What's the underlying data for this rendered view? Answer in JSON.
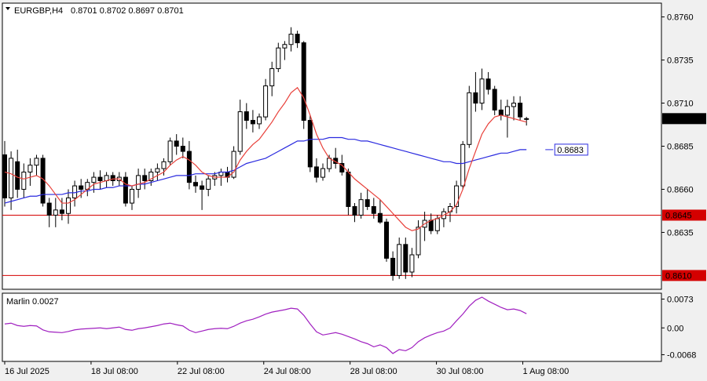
{
  "header": {
    "symbol": "EURGBP,H4",
    "ohlc": "0.8701 0.8702 0.8697 0.8701"
  },
  "indicator": {
    "label": "Marlin 0.0027"
  },
  "colors": {
    "bull": "#ffffff",
    "bear": "#000000",
    "ma_fast": "#e8403a",
    "ma_slow": "#2a2adf",
    "levels": "#d40000",
    "osc": "#a020c0",
    "price_tag": "#000000",
    "ma_tag": "#2a2adf"
  },
  "chart_data": [
    {
      "type": "candlestick",
      "price_axis": {
        "ticks": [
          "0.8760",
          "0.8735",
          "0.8710",
          "0.8685",
          "0.8660",
          "0.8635"
        ],
        "ylim": [
          0.8602,
          0.8768
        ]
      },
      "time_axis": {
        "labels": [
          "16 Jul 2025",
          "18 Jul 08:00",
          "22 Jul 08:00",
          "24 Jul 08:00",
          "28 Jul 08:00",
          "30 Jul 08:00",
          "1 Aug 08:00"
        ]
      },
      "current_price": "0.8701",
      "ma_value_label": "0.8683",
      "levels": [
        {
          "value": 0.8645,
          "label": "0.8645"
        },
        {
          "value": 0.861,
          "label": "0.8610"
        }
      ],
      "candles": [
        [
          0.868,
          0.8688,
          0.865,
          0.8655
        ],
        [
          0.8655,
          0.8682,
          0.8648,
          0.8678
        ],
        [
          0.8676,
          0.8683,
          0.8655,
          0.866
        ],
        [
          0.866,
          0.8675,
          0.8655,
          0.867
        ],
        [
          0.867,
          0.8678,
          0.8662,
          0.8674
        ],
        [
          0.8674,
          0.868,
          0.8668,
          0.8678
        ],
        [
          0.8678,
          0.868,
          0.865,
          0.8652
        ],
        [
          0.8652,
          0.8655,
          0.8638,
          0.8645
        ],
        [
          0.8645,
          0.8655,
          0.8638,
          0.8648
        ],
        [
          0.8648,
          0.8655,
          0.8642,
          0.8646
        ],
        [
          0.8646,
          0.866,
          0.864,
          0.8655
        ],
        [
          0.8655,
          0.8665,
          0.865,
          0.8662
        ],
        [
          0.8662,
          0.8666,
          0.8655,
          0.866
        ],
        [
          0.866,
          0.8666,
          0.8656,
          0.8664
        ],
        [
          0.8664,
          0.867,
          0.8658,
          0.8667
        ],
        [
          0.8667,
          0.8671,
          0.866,
          0.8665
        ],
        [
          0.8665,
          0.867,
          0.8661,
          0.8668
        ],
        [
          0.8668,
          0.867,
          0.8662,
          0.8665
        ],
        [
          0.8665,
          0.867,
          0.8662,
          0.8667
        ],
        [
          0.8667,
          0.867,
          0.865,
          0.8652
        ],
        [
          0.8652,
          0.8662,
          0.8648,
          0.866
        ],
        [
          0.866,
          0.8672,
          0.8655,
          0.8668
        ],
        [
          0.8668,
          0.8672,
          0.866,
          0.8665
        ],
        [
          0.8665,
          0.8672,
          0.8662,
          0.867
        ],
        [
          0.867,
          0.8675,
          0.8665,
          0.8672
        ],
        [
          0.8672,
          0.8678,
          0.8668,
          0.8676
        ],
        [
          0.8676,
          0.869,
          0.8674,
          0.8688
        ],
        [
          0.8688,
          0.8692,
          0.868,
          0.8685
        ],
        [
          0.8685,
          0.869,
          0.8678,
          0.8682
        ],
        [
          0.8682,
          0.8688,
          0.866,
          0.8664
        ],
        [
          0.8664,
          0.8668,
          0.8658,
          0.8662
        ],
        [
          0.8662,
          0.8665,
          0.8648,
          0.866
        ],
        [
          0.866,
          0.8668,
          0.8656,
          0.8666
        ],
        [
          0.8666,
          0.867,
          0.8662,
          0.8668
        ],
        [
          0.8668,
          0.8672,
          0.8662,
          0.867
        ],
        [
          0.867,
          0.8673,
          0.8664,
          0.8667
        ],
        [
          0.8667,
          0.8685,
          0.8666,
          0.8682
        ],
        [
          0.8682,
          0.8712,
          0.868,
          0.8705
        ],
        [
          0.8705,
          0.871,
          0.8695,
          0.87
        ],
        [
          0.87,
          0.8706,
          0.8693,
          0.8698
        ],
        [
          0.8698,
          0.8704,
          0.8695,
          0.8702
        ],
        [
          0.8702,
          0.8724,
          0.87,
          0.872
        ],
        [
          0.872,
          0.8734,
          0.8714,
          0.873
        ],
        [
          0.873,
          0.8745,
          0.8728,
          0.8742
        ],
        [
          0.8742,
          0.8746,
          0.8735,
          0.8744
        ],
        [
          0.8744,
          0.8754,
          0.874,
          0.875
        ],
        [
          0.875,
          0.8752,
          0.8742,
          0.8745
        ],
        [
          0.8745,
          0.8746,
          0.8695,
          0.87
        ],
        [
          0.87,
          0.8703,
          0.867,
          0.8673
        ],
        [
          0.8673,
          0.8678,
          0.8664,
          0.8667
        ],
        [
          0.8667,
          0.8675,
          0.8665,
          0.8672
        ],
        [
          0.8672,
          0.868,
          0.867,
          0.8678
        ],
        [
          0.8678,
          0.8684,
          0.8672,
          0.8675
        ],
        [
          0.8675,
          0.868,
          0.8668,
          0.867
        ],
        [
          0.867,
          0.8672,
          0.8645,
          0.865
        ],
        [
          0.865,
          0.8652,
          0.8641,
          0.8645
        ],
        [
          0.8645,
          0.8658,
          0.8643,
          0.8654
        ],
        [
          0.8654,
          0.866,
          0.8648,
          0.865
        ],
        [
          0.865,
          0.8655,
          0.8643,
          0.8646
        ],
        [
          0.8646,
          0.8654,
          0.864,
          0.8641
        ],
        [
          0.8641,
          0.8643,
          0.8618,
          0.862
        ],
        [
          0.862,
          0.8624,
          0.8607,
          0.861
        ],
        [
          0.861,
          0.8632,
          0.8608,
          0.8628
        ],
        [
          0.8628,
          0.8632,
          0.8608,
          0.8612
        ],
        [
          0.8612,
          0.8626,
          0.8609,
          0.8622
        ],
        [
          0.8622,
          0.8642,
          0.862,
          0.8638
        ],
        [
          0.8638,
          0.8647,
          0.863,
          0.8642
        ],
        [
          0.8642,
          0.8646,
          0.8634,
          0.8636
        ],
        [
          0.8636,
          0.8645,
          0.8634,
          0.8643
        ],
        [
          0.8643,
          0.8649,
          0.8638,
          0.8647
        ],
        [
          0.8647,
          0.8652,
          0.8641,
          0.865
        ],
        [
          0.865,
          0.8665,
          0.8646,
          0.8662
        ],
        [
          0.8662,
          0.8688,
          0.866,
          0.8686
        ],
        [
          0.8686,
          0.872,
          0.8684,
          0.8716
        ],
        [
          0.8716,
          0.8728,
          0.8705,
          0.871
        ],
        [
          0.871,
          0.873,
          0.8706,
          0.8724
        ],
        [
          0.8724,
          0.8728,
          0.8715,
          0.8718
        ],
        [
          0.8718,
          0.872,
          0.8703,
          0.8706
        ],
        [
          0.8706,
          0.8712,
          0.87,
          0.8703
        ],
        [
          0.8703,
          0.8712,
          0.869,
          0.8708
        ],
        [
          0.8708,
          0.8714,
          0.87,
          0.871
        ],
        [
          0.871,
          0.8714,
          0.87,
          0.8702
        ],
        [
          0.8701,
          0.8702,
          0.8697,
          0.8701
        ]
      ],
      "ma_fast": [
        0.867,
        0.8669,
        0.8667,
        0.8666,
        0.8667,
        0.8668,
        0.8666,
        0.8662,
        0.8657,
        0.8652,
        0.8652,
        0.8654,
        0.8657,
        0.866,
        0.8663,
        0.8664,
        0.8665,
        0.8666,
        0.8666,
        0.8663,
        0.8662,
        0.8663,
        0.8664,
        0.8666,
        0.8668,
        0.867,
        0.8674,
        0.8677,
        0.8679,
        0.8677,
        0.8674,
        0.867,
        0.8668,
        0.8667,
        0.8667,
        0.8667,
        0.867,
        0.8677,
        0.8682,
        0.8686,
        0.8689,
        0.8694,
        0.8699,
        0.8705,
        0.871,
        0.8716,
        0.8719,
        0.8713,
        0.8703,
        0.8692,
        0.8684,
        0.8678,
        0.8676,
        0.8674,
        0.867,
        0.8666,
        0.8663,
        0.866,
        0.8657,
        0.8654,
        0.865,
        0.8646,
        0.8642,
        0.8638,
        0.8636,
        0.8637,
        0.864,
        0.8642,
        0.8643,
        0.8645,
        0.8647,
        0.8651,
        0.866,
        0.8672,
        0.8682,
        0.8692,
        0.8698,
        0.8702,
        0.8703,
        0.8702,
        0.8701,
        0.87,
        0.8699
      ],
      "ma_slow": [
        0.8652,
        0.8653,
        0.8654,
        0.8655,
        0.8656,
        0.8656,
        0.8657,
        0.8657,
        0.8657,
        0.8657,
        0.8658,
        0.8658,
        0.8659,
        0.8659,
        0.866,
        0.866,
        0.8661,
        0.8661,
        0.8662,
        0.8662,
        0.8662,
        0.8663,
        0.8663,
        0.8664,
        0.8665,
        0.8666,
        0.8667,
        0.8668,
        0.8668,
        0.8668,
        0.8669,
        0.8669,
        0.8669,
        0.8669,
        0.867,
        0.867,
        0.8671,
        0.8673,
        0.8675,
        0.8676,
        0.8677,
        0.8678,
        0.868,
        0.8682,
        0.8684,
        0.8686,
        0.8688,
        0.8688,
        0.8689,
        0.8689,
        0.8689,
        0.869,
        0.869,
        0.869,
        0.8689,
        0.8689,
        0.8688,
        0.8688,
        0.8687,
        0.8686,
        0.8685,
        0.8684,
        0.8683,
        0.8682,
        0.8681,
        0.868,
        0.8679,
        0.8678,
        0.8677,
        0.8676,
        0.8676,
        0.8675,
        0.8675,
        0.8676,
        0.8677,
        0.8678,
        0.8679,
        0.868,
        0.8681,
        0.8681,
        0.8682,
        0.8683,
        0.8683
      ]
    },
    {
      "type": "line",
      "name": "Marlin",
      "y_axis": {
        "ticks": [
          "0.0073",
          "0.00",
          "-0.0068"
        ],
        "ylim": [
          -0.0085,
          0.0088
        ]
      },
      "values": [
        0.001,
        0.0012,
        0.0006,
        0.0004,
        0.0006,
        0.0005,
        -0.0005,
        -0.001,
        -0.0011,
        -0.0012,
        -0.0009,
        -0.0005,
        -0.0003,
        -0.0002,
        -0.0001,
        0.0,
        -0.0002,
        0.0,
        0.0002,
        -0.0004,
        -0.0006,
        -0.0002,
        0.0,
        0.0003,
        0.0006,
        0.001,
        0.0012,
        0.0008,
        0.0005,
        -0.0006,
        -0.0012,
        -0.0008,
        -0.0004,
        -0.0002,
        -0.0001,
        -0.0002,
        0.0004,
        0.0012,
        0.0018,
        0.0022,
        0.0028,
        0.0035,
        0.004,
        0.0043,
        0.0046,
        0.005,
        0.0048,
        0.0032,
        0.001,
        -0.001,
        -0.0018,
        -0.0015,
        -0.0012,
        -0.0016,
        -0.0022,
        -0.0028,
        -0.0035,
        -0.004,
        -0.0048,
        -0.0043,
        -0.005,
        -0.0065,
        -0.0055,
        -0.0058,
        -0.005,
        -0.0035,
        -0.0025,
        -0.0018,
        -0.0012,
        -0.0008,
        0.0,
        0.0018,
        0.0035,
        0.0055,
        0.007,
        0.0078,
        0.0068,
        0.006,
        0.0052,
        0.0046,
        0.0048,
        0.0044,
        0.0036
      ]
    }
  ]
}
